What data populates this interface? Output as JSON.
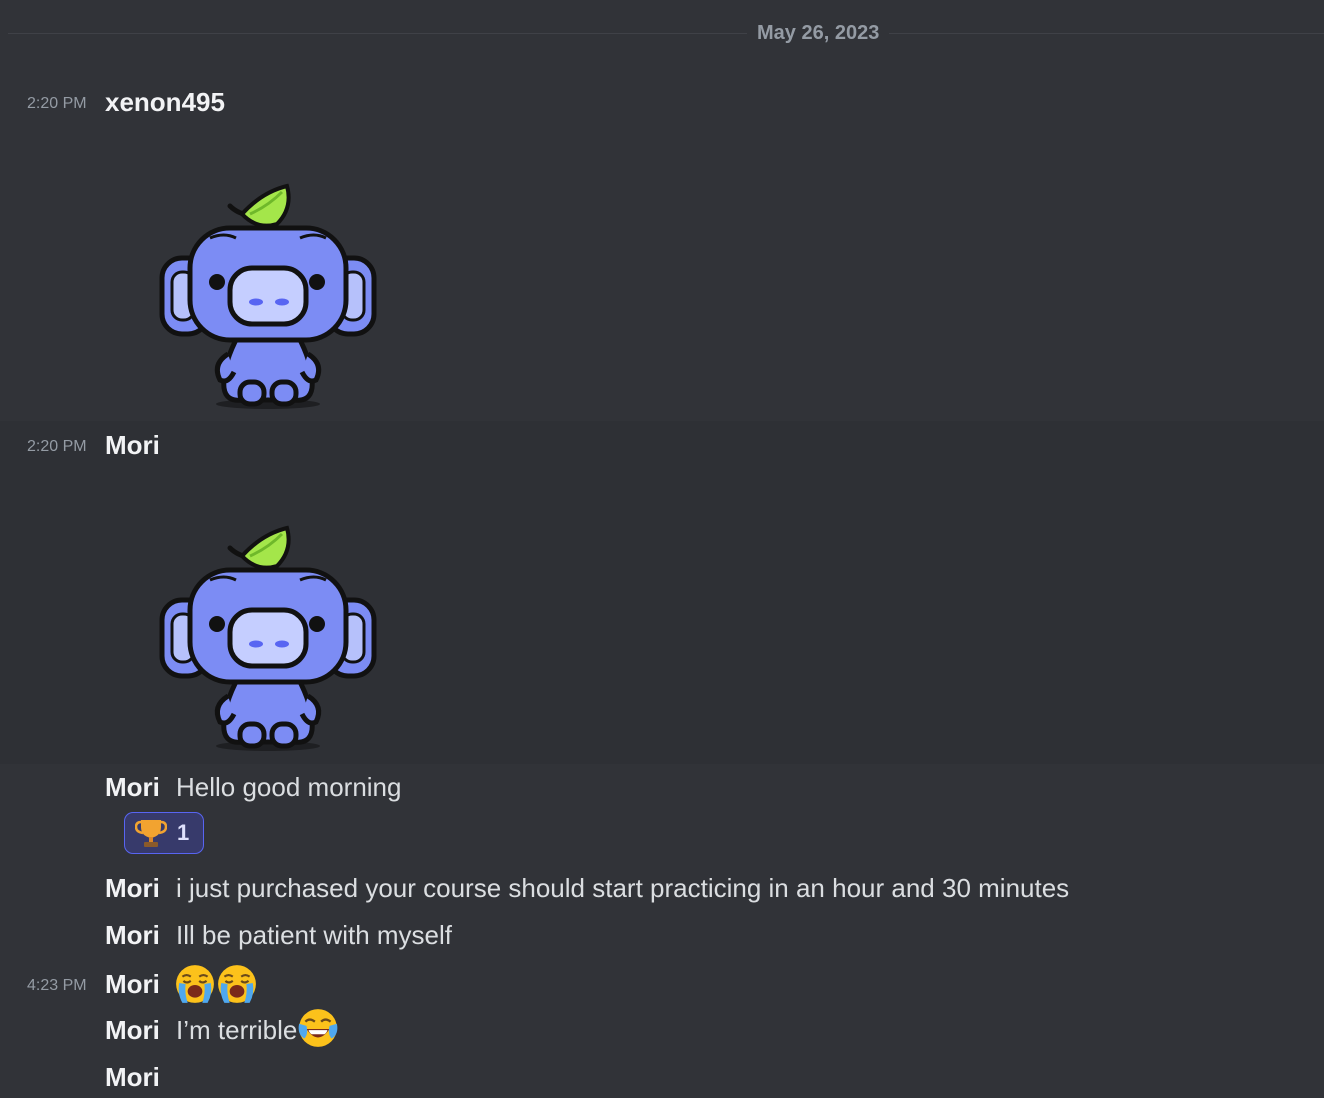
{
  "date_divider": "May 26, 2023",
  "messages": [
    {
      "timestamp": "2:20 PM",
      "author": "xenon495",
      "sticker": "wumpus-leaf-sticker"
    },
    {
      "timestamp": "2:20 PM",
      "author": "Mori",
      "sticker": "wumpus-leaf-sticker"
    },
    {
      "author": "Mori",
      "text": "Hello good morning",
      "reaction": {
        "emoji": "trophy-icon",
        "count": "1"
      }
    },
    {
      "author": "Mori",
      "text": "i just purchased your course should start practicing in an hour and 30 minutes"
    },
    {
      "author": "Mori",
      "text": "Ill be patient with myself"
    },
    {
      "timestamp": "4:23 PM",
      "author": "Mori",
      "emojis": [
        "loudly-crying-face-icon",
        "loudly-crying-face-icon"
      ]
    },
    {
      "author": "Mori",
      "text": "I’m terrible",
      "emojis": [
        "face-with-tears-of-joy-icon"
      ]
    },
    {
      "author": "Mori"
    }
  ],
  "colors": {
    "background": "#313338",
    "hover_background": "#2e3035",
    "reaction_border": "#5865f2",
    "reaction_background": "#373a6b",
    "wumpus_blue": "#7c8cf4"
  }
}
